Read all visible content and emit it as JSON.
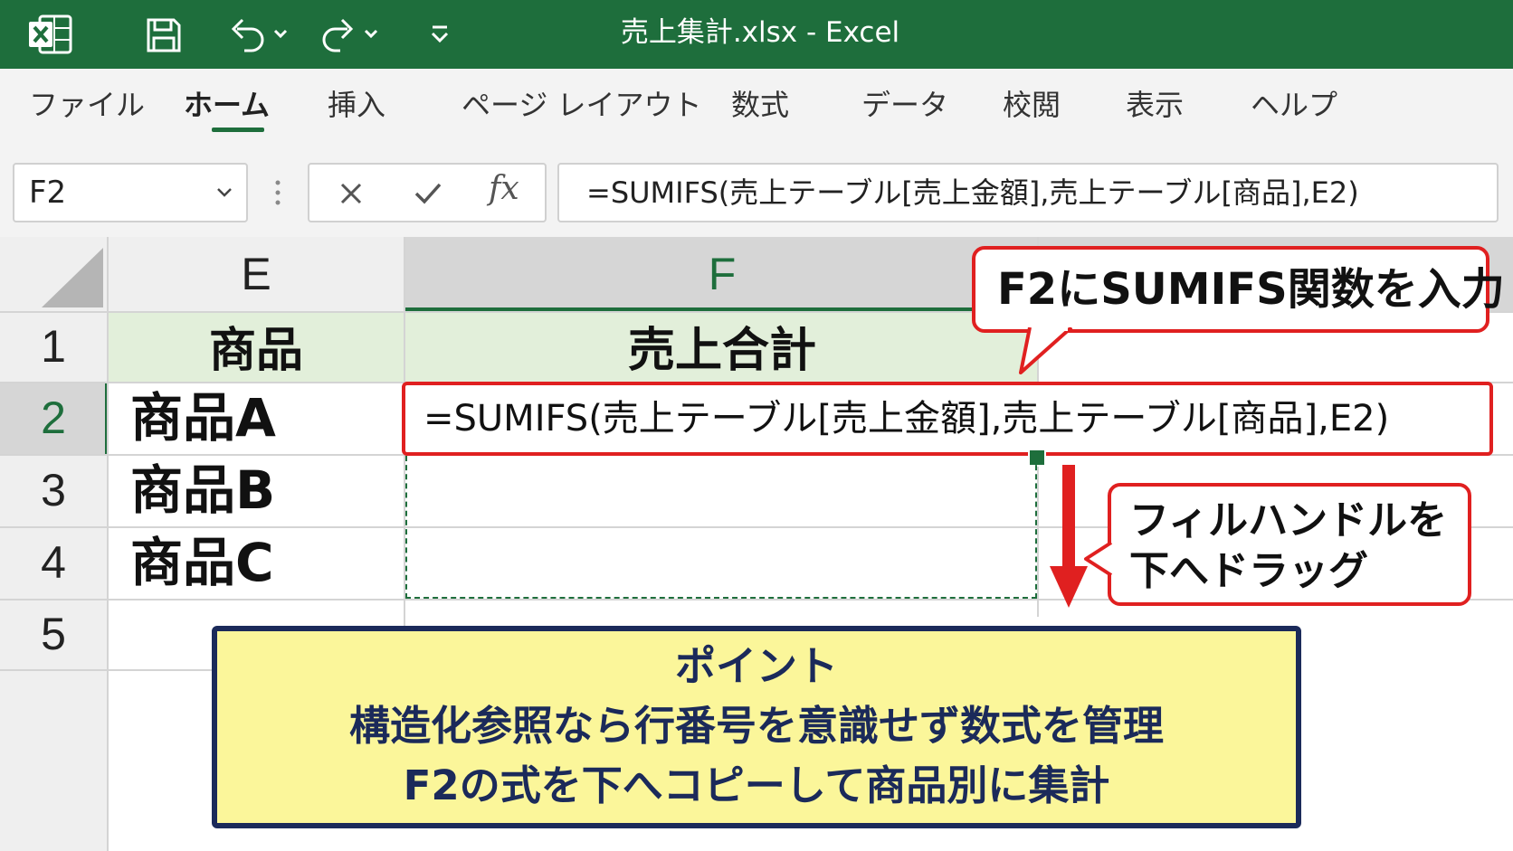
{
  "window": {
    "title": "売上集計.xlsx  -  Excel"
  },
  "ribbon": {
    "tabs": [
      {
        "label": "ファイル"
      },
      {
        "label": "ホーム"
      },
      {
        "label": "挿入"
      },
      {
        "label": "ページ レイアウト"
      },
      {
        "label": "数式"
      },
      {
        "label": "データ"
      },
      {
        "label": "校閲"
      },
      {
        "label": "表示"
      },
      {
        "label": "ヘルプ"
      }
    ],
    "active_tab": "ホーム"
  },
  "formula_bar": {
    "name_box": "F2",
    "fx_label": "fx",
    "formula": "=SUMIFS(売上テーブル[売上金額],売上テーブル[商品],E2)"
  },
  "grid": {
    "columns": [
      "E",
      "F"
    ],
    "rows": [
      "1",
      "2",
      "3",
      "4",
      "5"
    ],
    "cells": {
      "E1": "商品",
      "F1": "売上合計",
      "E2": "商品A",
      "F2": "=SUMIFS(売上テーブル[売上金額],売上テーブル[商品],E2)",
      "E3": "商品B",
      "E4": "商品C"
    },
    "selected_cell": "F2"
  },
  "annotations": {
    "callout_top": "F2にSUMIFS関数を入力",
    "callout_right_line1": "フィルハンドルを",
    "callout_right_line2": "下へドラッグ",
    "point_title": "ポイント",
    "point_line1": "構造化参照なら行番号を意識せず数式を管理",
    "point_line2": "F2の式を下へコピーして商品別に集計"
  },
  "colors": {
    "excel_green": "#1e6e3c",
    "header_fill": "#e2efda",
    "callout_red": "#e02020",
    "point_fill": "#fbf69a",
    "point_border": "#1b2a5a"
  }
}
